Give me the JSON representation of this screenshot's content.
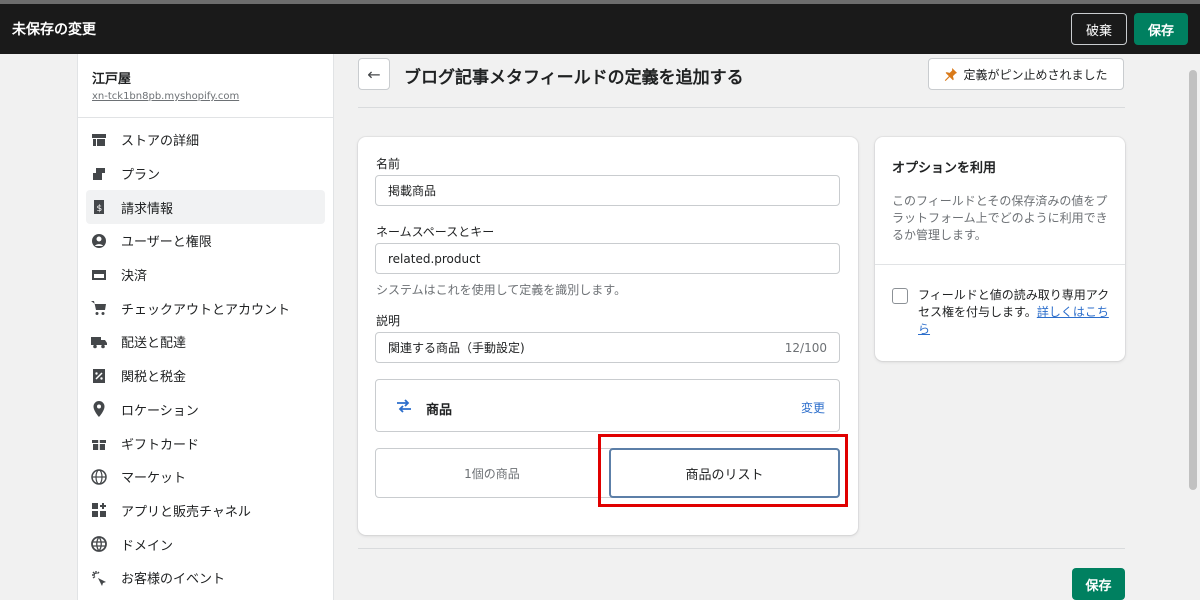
{
  "topbar": {
    "title": "未保存の変更",
    "discard_label": "破棄",
    "save_label": "保存"
  },
  "sidebar": {
    "store_name": "江戸屋",
    "store_domain": "xn-tck1bn8pb.myshopify.com",
    "items": [
      {
        "label": "ストアの詳細",
        "icon": "store-icon"
      },
      {
        "label": "プラン",
        "icon": "plan-icon"
      },
      {
        "label": "請求情報",
        "icon": "billing-icon",
        "active": true
      },
      {
        "label": "ユーザーと権限",
        "icon": "user-icon"
      },
      {
        "label": "決済",
        "icon": "payment-icon"
      },
      {
        "label": "チェックアウトとアカウント",
        "icon": "cart-icon"
      },
      {
        "label": "配送と配達",
        "icon": "truck-icon"
      },
      {
        "label": "関税と税金",
        "icon": "tax-icon"
      },
      {
        "label": "ロケーション",
        "icon": "location-icon"
      },
      {
        "label": "ギフトカード",
        "icon": "gift-icon"
      },
      {
        "label": "マーケット",
        "icon": "globe-icon"
      },
      {
        "label": "アプリと販売チャネル",
        "icon": "apps-icon"
      },
      {
        "label": "ドメイン",
        "icon": "domain-icon"
      },
      {
        "label": "お客様のイベント",
        "icon": "events-icon"
      }
    ]
  },
  "header": {
    "title": "ブログ記事メタフィールドの定義を追加する",
    "pin_label": "定義がピン止めされました"
  },
  "form": {
    "name_label": "名前",
    "name_value": "掲載商品",
    "namespace_label": "ネームスペースとキー",
    "namespace_value": "related.product",
    "namespace_help": "システムはこれを使用して定義を識別します。",
    "description_label": "説明",
    "description_value": "関連する商品（手動設定)",
    "description_count": "12/100",
    "type_name": "商品",
    "type_change": "変更",
    "option_single": "1個の商品",
    "option_list": "商品のリスト"
  },
  "side": {
    "title": "オプションを利用",
    "description": "このフィールドとその保存済みの値をプラットフォーム上でどのように利用できるか管理します。",
    "checkbox_text": "フィールドと値の読み取り専用アクセス権を付与します。",
    "learn_more": "詳しくはこちら"
  },
  "footer": {
    "save_label": "保存"
  },
  "colors": {
    "primary": "#008060",
    "link": "#2c6ecb",
    "highlight": "#e00000",
    "topbar": "#1a1a1a"
  }
}
